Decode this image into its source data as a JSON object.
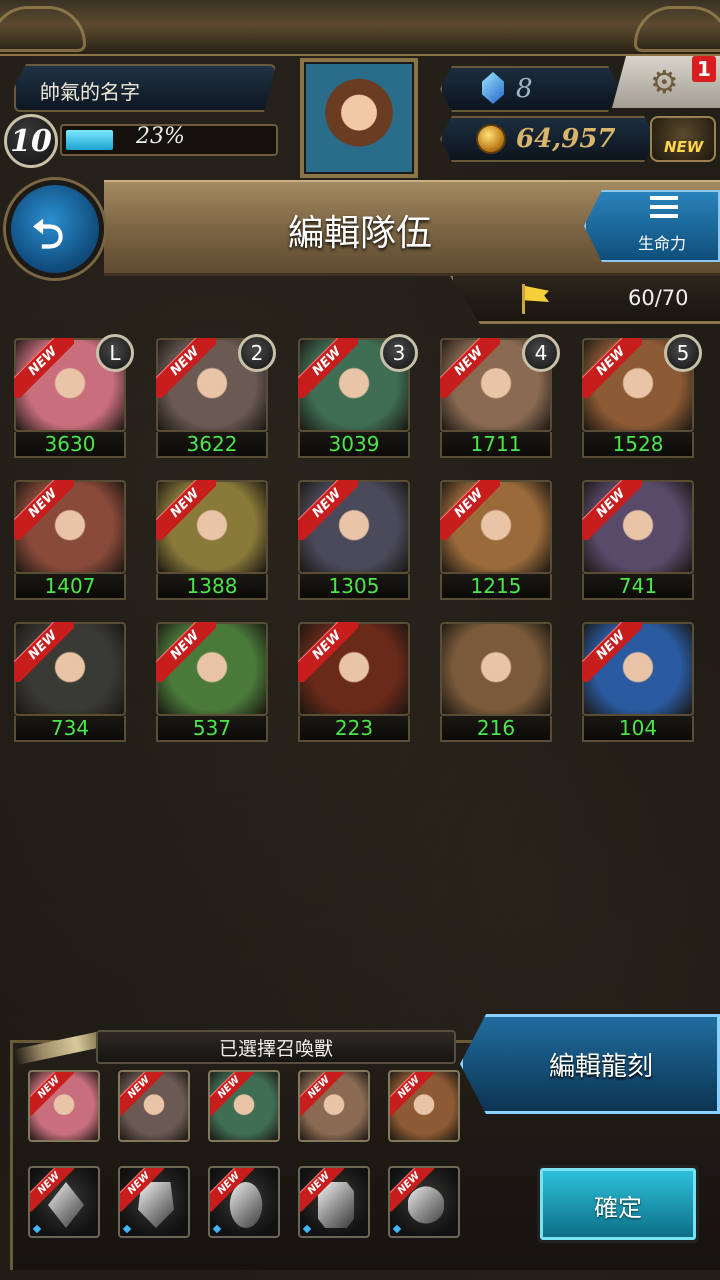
{
  "header": {
    "player_name": "帥氣的名字",
    "level": "10",
    "xp_percent_label": "23%",
    "xp_progress": 0.23,
    "gems": "8",
    "gold": "64,957",
    "notification_count": "1",
    "shop_new_label": "NEW"
  },
  "title_bar": {
    "title": "編輯隊伍",
    "sort_label": "生命力"
  },
  "capacity": {
    "label": "60/70"
  },
  "monsters": [
    {
      "value": "3630",
      "badge": "L",
      "new": "NEW",
      "color": "#c86e7c"
    },
    {
      "value": "3622",
      "badge": "2",
      "new": "NEW",
      "color": "#6b5a54"
    },
    {
      "value": "3039",
      "badge": "3",
      "new": "NEW",
      "color": "#3f6e54"
    },
    {
      "value": "1711",
      "badge": "4",
      "new": "NEW",
      "color": "#8a6a52"
    },
    {
      "value": "1528",
      "badge": "5",
      "new": "NEW",
      "color": "#8c5a34"
    },
    {
      "value": "1407",
      "badge": "",
      "new": "NEW",
      "color": "#8a4a3a"
    },
    {
      "value": "1388",
      "badge": "",
      "new": "NEW",
      "color": "#8a7a3a"
    },
    {
      "value": "1305",
      "badge": "",
      "new": "NEW",
      "color": "#4a4a5a"
    },
    {
      "value": "1215",
      "badge": "",
      "new": "NEW",
      "color": "#9a6a3a"
    },
    {
      "value": "741",
      "badge": "",
      "new": "NEW",
      "color": "#5a4a6a"
    },
    {
      "value": "734",
      "badge": "",
      "new": "NEW",
      "color": "#3a3a34"
    },
    {
      "value": "537",
      "badge": "",
      "new": "NEW",
      "color": "#4a7a3a"
    },
    {
      "value": "223",
      "badge": "",
      "new": "NEW",
      "color": "#6a2a1a"
    },
    {
      "value": "216",
      "badge": "",
      "new": "",
      "color": "#7a5a3a"
    },
    {
      "value": "104",
      "badge": "",
      "new": "NEW",
      "color": "#2a5aa0"
    }
  ],
  "selected": {
    "title": "已選擇召喚獸",
    "monsters": [
      {
        "new": "NEW",
        "color": "#c86e7c"
      },
      {
        "new": "NEW",
        "color": "#6b5a54"
      },
      {
        "new": "NEW",
        "color": "#3f6e54"
      },
      {
        "new": "NEW",
        "color": "#8a6a52"
      },
      {
        "new": "NEW",
        "color": "#8c5a34"
      }
    ],
    "runes": [
      {
        "new": "NEW",
        "shape": "diamond"
      },
      {
        "new": "NEW",
        "shape": "shield"
      },
      {
        "new": "NEW",
        "shape": "oval"
      },
      {
        "new": "NEW",
        "shape": "hexagon"
      },
      {
        "new": "NEW",
        "shape": "circle"
      }
    ]
  },
  "buttons": {
    "edit_rune": "編輯龍刻",
    "confirm": "確定"
  }
}
